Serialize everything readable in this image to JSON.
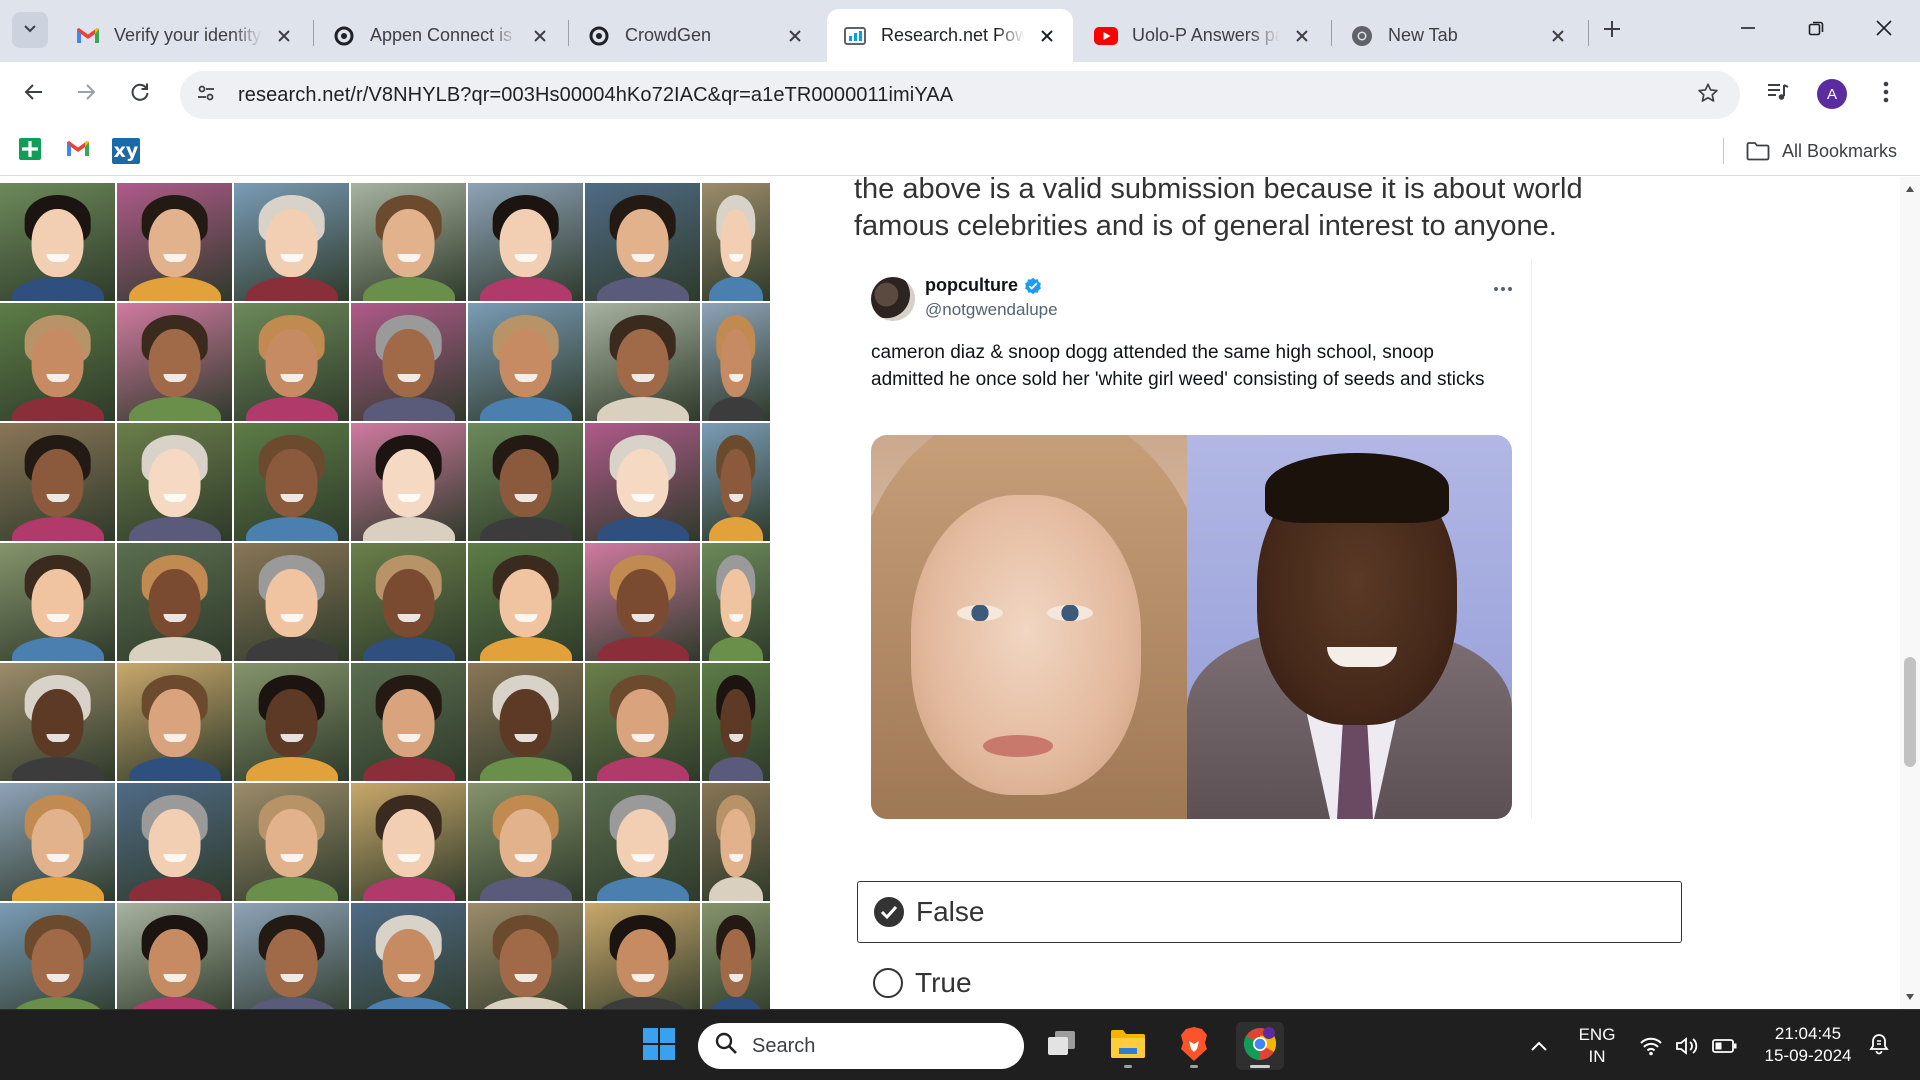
{
  "browser": {
    "tabs": [
      {
        "title": "Verify your identity",
        "icon": "gmail-icon"
      },
      {
        "title": "Appen Connect is r",
        "icon": "appen-icon"
      },
      {
        "title": "CrowdGen",
        "icon": "crowdgen-icon"
      },
      {
        "title": "Research.net Powe",
        "icon": "research-net-icon",
        "active": true
      },
      {
        "title": "Uolo-P Answers pa",
        "icon": "youtube-icon"
      },
      {
        "title": "New Tab",
        "icon": "chrome-icon"
      }
    ],
    "url": "research.net/r/V8NHYLB?qr=003Hs00004hKo72IAC&qr=a1eTR0000011imiYAA",
    "profile_initial": "A",
    "bookmarks": {
      "items": [
        {
          "name": "sheets",
          "icon": "google-sheets-icon"
        },
        {
          "name": "gmail",
          "icon": "gmail-icon"
        },
        {
          "name": "xy",
          "label": "xy"
        }
      ],
      "all_bookmarks_label": "All Bookmarks"
    }
  },
  "survey": {
    "question_text": "the above is a valid submission because it is about world famous celebrities and is of general interest to anyone.",
    "tweet": {
      "display_name": "popculture",
      "handle": "@notgwendalupe",
      "text": "cameron diaz & snoop dogg attended the same high school, snoop admitted he once sold her 'white girl weed' consisting of seeds and sticks"
    },
    "options": [
      {
        "label": "False",
        "selected": true
      },
      {
        "label": "True",
        "selected": false
      }
    ]
  },
  "taskbar": {
    "search_label": "Search",
    "language": "ENG",
    "region": "IN",
    "time": "21:04:45",
    "date": "15-09-2024"
  },
  "colors": {
    "tabstrip_bg": "#dfe3eb",
    "omnibox_bg": "#eef0f4",
    "avatar_bg": "#5b2c9f",
    "verified_blue": "#1d9bf0",
    "taskbar_bg": "#1f1f1f"
  }
}
